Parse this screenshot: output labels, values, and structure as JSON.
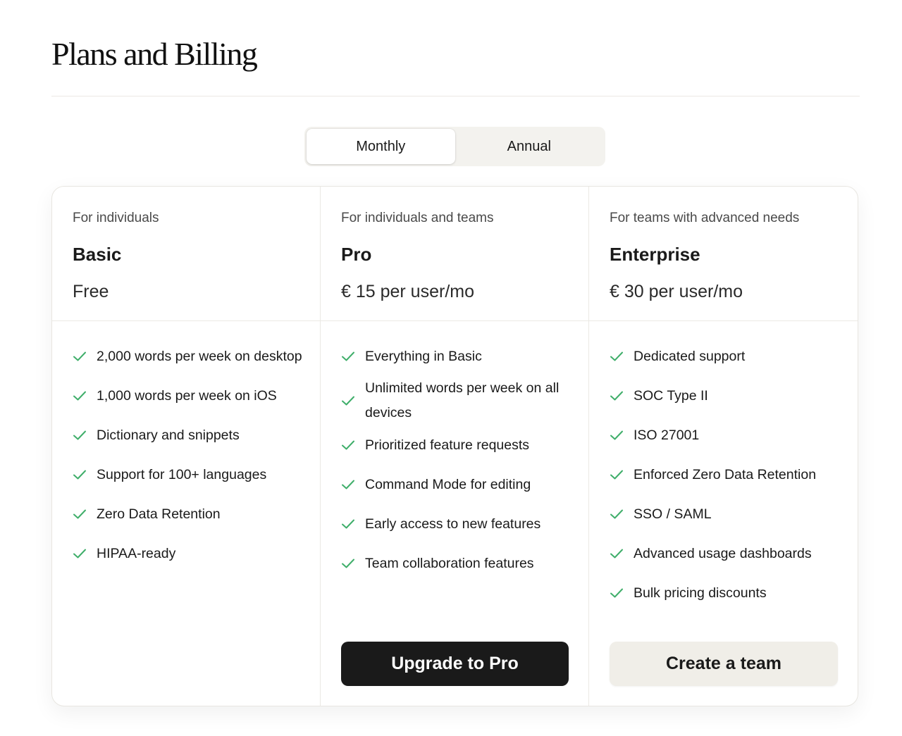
{
  "page": {
    "title": "Plans and Billing"
  },
  "billing_toggle": {
    "monthly_label": "Monthly",
    "annual_label": "Annual",
    "selected": "Monthly"
  },
  "colors": {
    "check": "#3fae6a",
    "primary_button": "#1a1a1a",
    "secondary_button": "#f0eee8"
  },
  "plans": [
    {
      "audience": "For individuals",
      "name": "Basic",
      "price": "Free",
      "features": [
        "2,000 words per week on desktop",
        "1,000 words per week on iOS",
        "Dictionary and snippets",
        "Support for 100+ languages",
        "Zero Data Retention",
        "HIPAA-ready"
      ]
    },
    {
      "audience": "For individuals and teams",
      "name": "Pro",
      "price": "€ 15 per user/mo",
      "features": [
        "Everything in Basic",
        "Unlimited words per week on all devices",
        "Prioritized feature requests",
        "Command Mode for editing",
        "Early access to new features",
        "Team collaboration features"
      ],
      "cta": "Upgrade to Pro"
    },
    {
      "audience": "For teams with advanced needs",
      "name": "Enterprise",
      "price": "€ 30 per user/mo",
      "features": [
        "Dedicated support",
        "SOC Type II",
        "ISO 27001",
        "Enforced Zero Data Retention",
        "SSO / SAML",
        "Advanced usage dashboards",
        "Bulk pricing discounts"
      ],
      "cta": "Create a team"
    }
  ]
}
